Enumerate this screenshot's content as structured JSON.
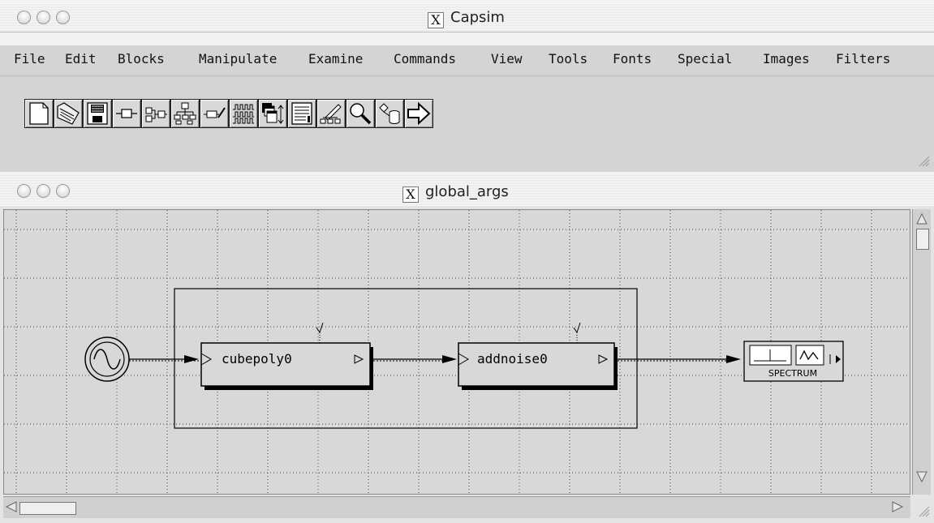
{
  "top_window": {
    "title": "Capsim",
    "title_icon_glyph": "X",
    "menu": [
      "File",
      "Edit",
      "Blocks",
      "Manipulate",
      "Examine",
      "Commands",
      "View",
      "Tools",
      "Fonts",
      "Special",
      "Images",
      "Filters"
    ],
    "tools": [
      "new-file-icon",
      "open-folder-icon",
      "save-icon",
      "block-icon",
      "connect-blocks-icon",
      "hierarchy-icon",
      "edit-block-icon",
      "waveform-icon",
      "window-stack-icon",
      "list-text-icon",
      "edit-tree-icon",
      "magnifier-icon",
      "database-icon",
      "arrow-right-icon"
    ]
  },
  "diagram_window": {
    "title": "global_args",
    "title_icon_glyph": "X",
    "blocks": {
      "cubepoly": "cubepoly0",
      "addnoise": "addnoise0",
      "spectrum": "SPECTRUM"
    }
  },
  "colors": {
    "canvas_bg": "#d8d8d8",
    "grid": "#555555",
    "menubar_bg": "#d4d4d4"
  }
}
